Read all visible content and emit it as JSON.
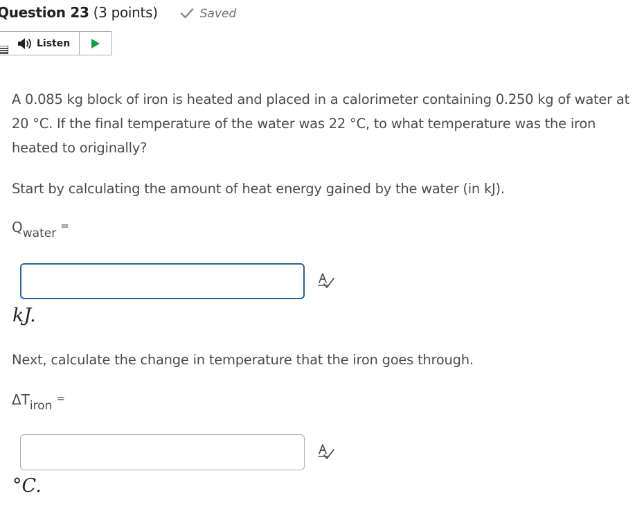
{
  "question": {
    "title": "Question 23",
    "points": "(3 points)",
    "status": "Saved"
  },
  "listen": {
    "label": "Listen"
  },
  "body": {
    "prompt": "A 0.085 kg block of iron is heated and placed in a calorimeter containing 0.250 kg of water at 20 °C.  If the final temperature of the water was 22 °C, to what temperature was the iron heated to originally?",
    "step1": "Start by calculating the amount of heat energy gained by the water (in kJ).",
    "step2": "Next, calculate the change in temperature that the iron goes through."
  },
  "part1": {
    "var_main": "Q",
    "var_sub": "water",
    "equals": "=",
    "input_value": "",
    "unit": "kJ."
  },
  "part2": {
    "var_main": "ΔT",
    "var_sub": "iron",
    "equals": "=",
    "input_value": "",
    "unit": "°C."
  },
  "icons": {
    "saved": "checkmark-icon",
    "menu": "menu-icon",
    "listen": "speaker-icon",
    "play": "play-icon",
    "spellcheck": "spellcheck-icon"
  },
  "colors": {
    "accent": "#2a6496",
    "play": "#109e3d",
    "text": "#494c4e",
    "heading": "#202122"
  }
}
